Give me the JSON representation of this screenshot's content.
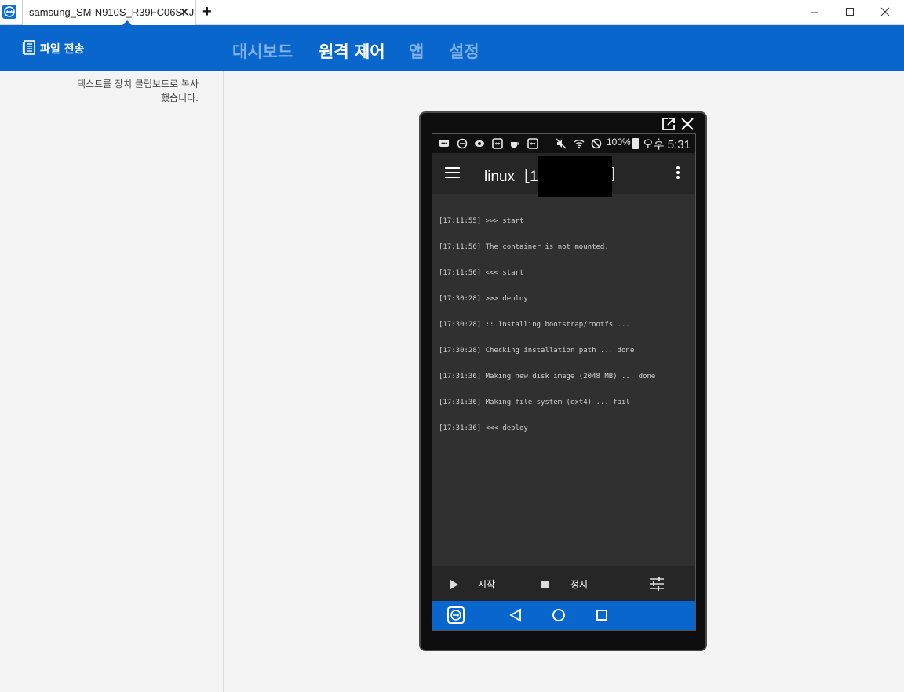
{
  "titlebar": {
    "tab_label": "samsung_SM-N910S_R39FC06SKJ",
    "tab_close": "✕",
    "new_tab": "+"
  },
  "header": {
    "file_transfer": "파일 전송",
    "nav": [
      {
        "label": "대시보드",
        "active": false
      },
      {
        "label": "원격 제어",
        "active": true
      },
      {
        "label": "앱",
        "active": false
      },
      {
        "label": "설정",
        "active": false
      }
    ]
  },
  "sidebar": {
    "message_line1": "텍스트를 장치 클립보드로 복사",
    "message_line2": "했습니다."
  },
  "device": {
    "status": {
      "battery": "100%",
      "time": "오후 5:31"
    },
    "app": {
      "title": "linux［1",
      "title_suffix": "］"
    },
    "log": [
      "[17:11:55] >>> start",
      "[17:11:56] The container is not mounted.",
      "[17:11:56] <<< start",
      "[17:30:28] >>> deploy",
      "[17:30:28] :: Installing bootstrap/rootfs ...",
      "[17:30:28] Checking installation path ... done",
      "[17:31:36] Making new disk image (2048 MB) ... done",
      "[17:31:36] Making file system (ext4) ... fail",
      "[17:31:36] <<< deploy"
    ],
    "bottom": {
      "start": "시작",
      "stop": "정지"
    }
  },
  "colors": {
    "brand_blue": "#0866cc",
    "screen_bg": "#303030",
    "nav_inactive": "#7fb0e6"
  }
}
